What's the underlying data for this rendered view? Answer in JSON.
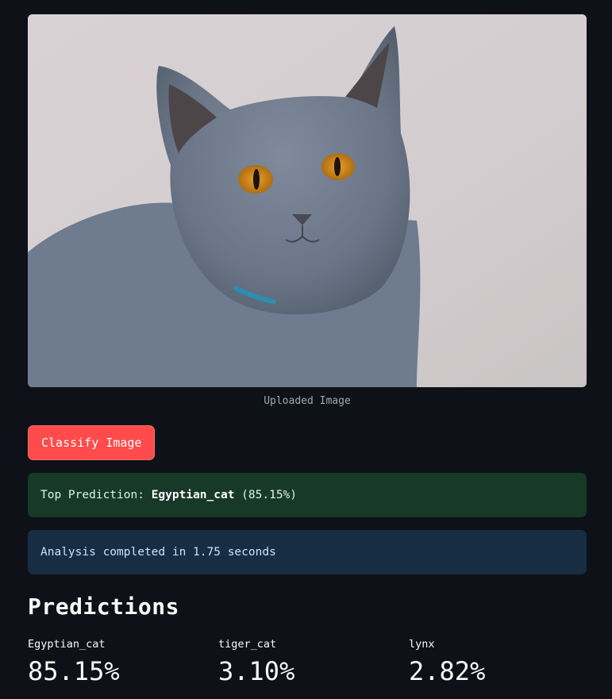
{
  "image": {
    "caption": "Uploaded Image",
    "subject": "gray cat photo"
  },
  "actions": {
    "classify_label": "Classify Image"
  },
  "success_alert": {
    "prefix": "Top Prediction: ",
    "label": "Egyptian_cat",
    "suffix": " (85.15%)"
  },
  "info_alert": {
    "text": "Analysis completed in 1.75 seconds"
  },
  "predictions": {
    "title": "Predictions",
    "items": [
      {
        "label": "Egyptian_cat",
        "value": "85.15%"
      },
      {
        "label": "tiger_cat",
        "value": "3.10%"
      },
      {
        "label": "lynx",
        "value": "2.82%"
      }
    ]
  },
  "colors": {
    "background": "#0e1117",
    "button": "#ff4b4b",
    "success_bg": "#173928",
    "info_bg": "#172d43"
  }
}
